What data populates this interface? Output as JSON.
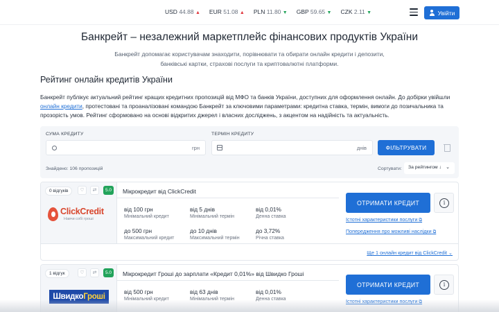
{
  "header": {
    "rates": [
      {
        "code": "USD",
        "value": "44.88",
        "dir": "up"
      },
      {
        "code": "EUR",
        "value": "51.08",
        "dir": "up"
      },
      {
        "code": "PLN",
        "value": "11.80",
        "dir": "down"
      },
      {
        "code": "GBP",
        "value": "59.65",
        "dir": "down"
      },
      {
        "code": "CZK",
        "value": "2.11",
        "dir": "down"
      }
    ],
    "login_label": "Увійти",
    "arrow_up": "▲",
    "arrow_down": "▼"
  },
  "page": {
    "title": "Банкрейт – незалежний маркетплейс фінансових продуктів України",
    "subtitle": "Банкрейт допомагає користувачам знаходити, порівнювати та обирати онлайн кредити і депозити, банківські картки, страхові послуги та криптовалютні платформи.",
    "section_title": "Рейтинг онлайн кредитів України",
    "intro_before": "Банкрейт публікує актуальний рейтинг кращих кредитних пропозицій від МФО та банків України, доступних для оформлення онлайн. До добірки увійшли ",
    "intro_link": "онлайн кредити",
    "intro_after": ", протестовані та проаналізовані командою Банкрейт за ключовими параметрами: кредитна ставка, термін, вимоги до позичальника та прозорість умов. Рейтинг сформовано на основі відкритих джерел і власних досліджень, з акцентом на надійність та актуальність."
  },
  "filter": {
    "amount_label": "СУМА КРЕДИТУ",
    "amount_unit": "грн",
    "term_label": "ТЕРМІН КРЕДИТУ",
    "term_unit": "днів",
    "filter_button": "ФІЛЬТРУВАТИ",
    "found_text": "Знайдено: 106 пропозицій",
    "sort_label": "Сортувати:",
    "sort_value": "За рейтингом ↓"
  },
  "offers": [
    {
      "reviews": "0 відгуків",
      "score": "5.0",
      "title": "Мікрокредит від ClickCredit",
      "logo_name": "ClickCredit",
      "logo_tag": "Навчи собі гроші",
      "min_amount": "від 100 грн",
      "min_amount_label": "Мінімальний кредит",
      "min_term": "від 5 днів",
      "min_term_label": "Мінімальний термін",
      "rate_day": "від 0,01%",
      "rate_day_label": "Денна ставка",
      "max_amount": "до 500 грн",
      "max_amount_label": "Максимальний кредит",
      "max_term": "до 10 днів",
      "max_term_label": "Максимальний термін",
      "rate_year": "до 3,72%",
      "rate_year_label": "Річна ставка",
      "cta": "ОТРИМАТИ КРЕДИТ",
      "link1": "Істотні характеристики послуги",
      "link2": "Попередження про можливі наслідки",
      "more": "Ще 1 онлайн кредит від ClickCredit"
    },
    {
      "reviews": "1 відгук",
      "score": "5.0",
      "title": "Мікрокредит Гроші до зарплати «Кредит 0,01%» від Швидко Гроші",
      "logo_a": "Швидко",
      "logo_b": "Гроші",
      "min_amount": "від 500 грн",
      "min_amount_label": "Мінімальний кредит",
      "min_term": "від 63 днів",
      "min_term_label": "Мінімальний термін",
      "rate_day": "від 0,01%",
      "rate_day_label": "Денна ставка",
      "cta": "ОТРИМАТИ КРЕДИТ",
      "link1": "Істотні характеристики послуги"
    }
  ],
  "icons": {
    "external": "⧉",
    "chevron": "⌄",
    "info": "i",
    "heart": "♡",
    "compare": "⇄"
  },
  "colors": {
    "accent": "#1f6fd6",
    "score": "#22a35a",
    "rate_up": "#e0383e",
    "rate_down": "#22a35a"
  }
}
